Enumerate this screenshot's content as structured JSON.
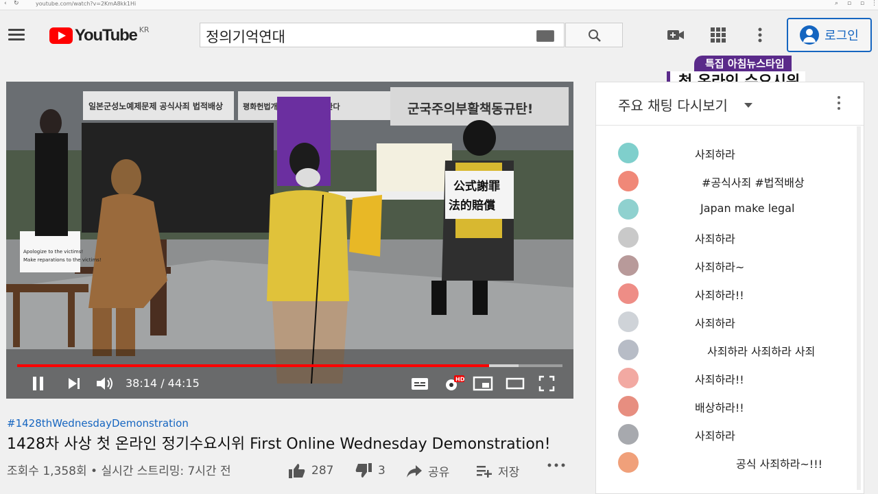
{
  "browser": {
    "url": "youtube.com/watch?v=2KmA8kk1Hi"
  },
  "header": {
    "logo_text": "YouTube",
    "region": "KR",
    "search_value": "정의기억연대",
    "login_label": "로그인"
  },
  "overlay": {
    "tag": "특집 아침뉴스타임",
    "headline": "첫 온라인 수요시위"
  },
  "player": {
    "time": "38:14 / 44:15",
    "progress": 0.865,
    "buffered": 0.92,
    "banners": [
      "일본군성노예제문제 공식사죄 법적배상",
      "평화헌법개정 ...정권 규탄한다",
      "군국주의부활책동규탄!"
    ],
    "sign_left": [
      "Apologize to the victims!",
      "Make reparations to the victims!"
    ],
    "sign_right": [
      "公式謝罪",
      "法的賠償"
    ],
    "hd_badge": "HD"
  },
  "video": {
    "hashtag": "#1428thWednesdayDemonstration",
    "title": "1428차 사상 첫 온라인 정기수요시위 First Online Wednesday Demonstration!",
    "meta": "조회수 1,358회 • 실시간 스트리밍: 7시간 전",
    "likes": "287",
    "dislikes": "3",
    "share": "공유",
    "save": "저장"
  },
  "chat": {
    "header": "주요 채팅 다시보기",
    "messages": [
      "사죄하라",
      "#공식사죄 #법적배상",
      "Japan make legal",
      "사죄하라",
      "사죄하라~",
      "사죄하라!!",
      "사죄하라",
      "사죄하라 사죄하라 사죄",
      "사죄하라!!",
      "배상하라!!",
      "사죄하라",
      "공식 사죄하라~!!!"
    ]
  }
}
